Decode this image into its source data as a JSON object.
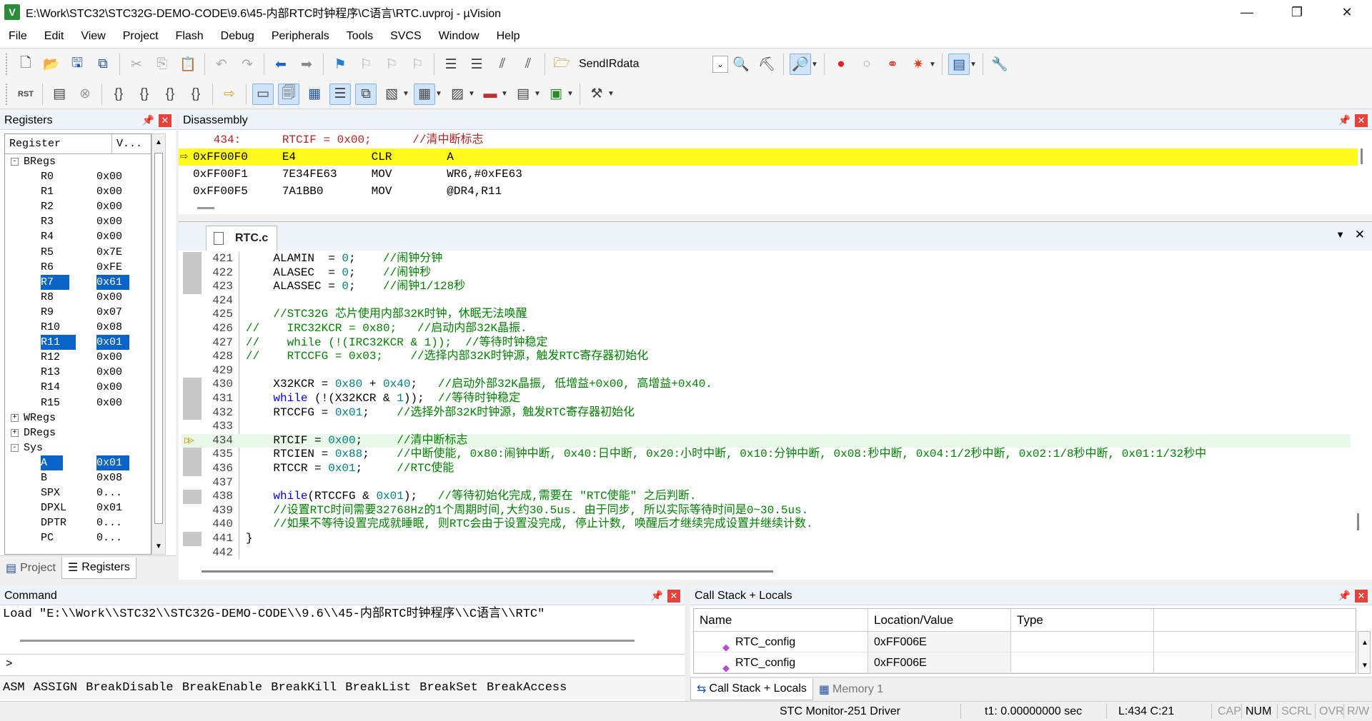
{
  "titlebar": {
    "title": "E:\\Work\\STC32\\STC32G-DEMO-CODE\\9.6\\45-内部RTC时钟程序\\C语言\\RTC.uvproj - µVision",
    "app_icon": "V",
    "min": "—",
    "max": "❐",
    "close": "✕"
  },
  "menu": [
    "File",
    "Edit",
    "View",
    "Project",
    "Flash",
    "Debug",
    "Peripherals",
    "Tools",
    "SVCS",
    "Window",
    "Help"
  ],
  "toolbar": {
    "target_name": "SendIRdata"
  },
  "registers": {
    "title": "Registers",
    "col_register": "Register",
    "col_value": "V...",
    "rows": [
      {
        "name": "BRegs",
        "value": "",
        "group": true,
        "expanded": "-"
      },
      {
        "name": "R0",
        "value": "0x00"
      },
      {
        "name": "R1",
        "value": "0x00"
      },
      {
        "name": "R2",
        "value": "0x00"
      },
      {
        "name": "R3",
        "value": "0x00"
      },
      {
        "name": "R4",
        "value": "0x00"
      },
      {
        "name": "R5",
        "value": "0x7E"
      },
      {
        "name": "R6",
        "value": "0xFE"
      },
      {
        "name": "R7",
        "value": "0x61",
        "selected": true
      },
      {
        "name": "R8",
        "value": "0x00"
      },
      {
        "name": "R9",
        "value": "0x07"
      },
      {
        "name": "R10",
        "value": "0x08"
      },
      {
        "name": "R11",
        "value": "0x01",
        "selected": true
      },
      {
        "name": "R12",
        "value": "0x00"
      },
      {
        "name": "R13",
        "value": "0x00"
      },
      {
        "name": "R14",
        "value": "0x00"
      },
      {
        "name": "R15",
        "value": "0x00"
      },
      {
        "name": "WRegs",
        "value": "",
        "group": true,
        "expanded": "+"
      },
      {
        "name": "DRegs",
        "value": "",
        "group": true,
        "expanded": "+"
      },
      {
        "name": "Sys",
        "value": "",
        "group": true,
        "expanded": "-"
      },
      {
        "name": "A",
        "value": "0x01",
        "selected": true
      },
      {
        "name": "B",
        "value": "0x08"
      },
      {
        "name": "SPX",
        "value": "0..."
      },
      {
        "name": "DPXL",
        "value": "0x01"
      },
      {
        "name": "DPTR",
        "value": "0..."
      },
      {
        "name": "PC",
        "value": "0..."
      }
    ],
    "tabs": [
      "Project",
      "Registers"
    ]
  },
  "disassembly": {
    "title": "Disassembly",
    "lines": [
      {
        "text": "   434:      RTCIF = 0x00;      //清中断标志",
        "kind": "src"
      },
      {
        "text": "0xFF00F0     E4           CLR        A",
        "kind": "current"
      },
      {
        "text": "0xFF00F1     7E34FE63     MOV        WR6,#0xFE63",
        "kind": "asm"
      },
      {
        "text": "0xFF00F5     7A1BB0       MOV        @DR4,R11",
        "kind": "asm"
      }
    ]
  },
  "editor": {
    "file_tab": "RTC.c",
    "lines": [
      {
        "n": "421",
        "t": "    ALAMIN  = 0;    //闹钟分钟"
      },
      {
        "n": "422",
        "t": "    ALASEC  = 0;    //闹钟秒"
      },
      {
        "n": "423",
        "t": "    ALASSEC = 0;    //闹钟1/128秒"
      },
      {
        "n": "424",
        "t": ""
      },
      {
        "n": "425",
        "t": "    //STC32G 芯片使用内部32K时钟，休眠无法唤醒"
      },
      {
        "n": "426",
        "t": "//    IRC32KCR = 0x80;   //启动内部32K晶振."
      },
      {
        "n": "427",
        "t": "//    while (!(IRC32KCR & 1));  //等待时钟稳定"
      },
      {
        "n": "428",
        "t": "//    RTCCFG = 0x03;    //选择内部32K时钟源，触发RTC寄存器初始化"
      },
      {
        "n": "429",
        "t": ""
      },
      {
        "n": "430",
        "t": "    X32KCR = 0x80 + 0x40;   //启动外部32K晶振, 低增益+0x00, 高增益+0x40."
      },
      {
        "n": "431",
        "t": "    while (!(X32KCR & 1));  //等待时钟稳定"
      },
      {
        "n": "432",
        "t": "    RTCCFG = 0x01;    //选择外部32K时钟源，触发RTC寄存器初始化"
      },
      {
        "n": "433",
        "t": ""
      },
      {
        "n": "434",
        "t": "    RTCIF = 0x00;     //清中断标志"
      },
      {
        "n": "435",
        "t": "    RTCIEN = 0x88;    //中断使能, 0x80:闹钟中断, 0x40:日中断, 0x20:小时中断, 0x10:分钟中断, 0x08:秒中断, 0x04:1/2秒中断, 0x02:1/8秒中断, 0x01:1/32秒中"
      },
      {
        "n": "436",
        "t": "    RTCCR = 0x01;     //RTC使能"
      },
      {
        "n": "437",
        "t": ""
      },
      {
        "n": "438",
        "t": "    while(RTCCFG & 0x01);   //等待初始化完成,需要在 \"RTC使能\" 之后判断."
      },
      {
        "n": "439",
        "t": "    //设置RTC时间需要32768Hz的1个周期时间,大约30.5us. 由于同步, 所以实际等待时间是0~30.5us."
      },
      {
        "n": "440",
        "t": "    //如果不等待设置完成就睡眠, 则RTC会由于设置没完成, 停止计数, 唤醒后才继续完成设置并继续计数."
      },
      {
        "n": "441",
        "t": "}"
      },
      {
        "n": "442",
        "t": ""
      }
    ]
  },
  "command": {
    "title": "Command",
    "output": "Load \"E:\\\\Work\\\\STC32\\\\STC32G-DEMO-CODE\\\\9.6\\\\45-内部RTC时钟程序\\\\C语言\\\\RTC\"",
    "prompt": ">",
    "input_value": "",
    "hints": "ASM ASSIGN BreakDisable BreakEnable BreakKill BreakList BreakSet BreakAccess"
  },
  "callstack": {
    "title": "Call Stack + Locals",
    "col_name": "Name",
    "col_location": "Location/Value",
    "col_type": "Type",
    "rows": [
      {
        "name": "RTC_config",
        "location": "0xFF006E",
        "type": ""
      },
      {
        "name": "RTC_config",
        "location": "0xFF006E",
        "type": ""
      }
    ],
    "tabs": [
      "Call Stack + Locals",
      "Memory 1"
    ]
  },
  "statusbar": {
    "driver": "STC Monitor-251 Driver",
    "time": "t1: 0.00000000 sec",
    "position": "L:434 C:21",
    "cap": "CAP",
    "num": "NUM",
    "scrl": "SCRL",
    "ovr": "OVR",
    "rw": "R/W"
  }
}
